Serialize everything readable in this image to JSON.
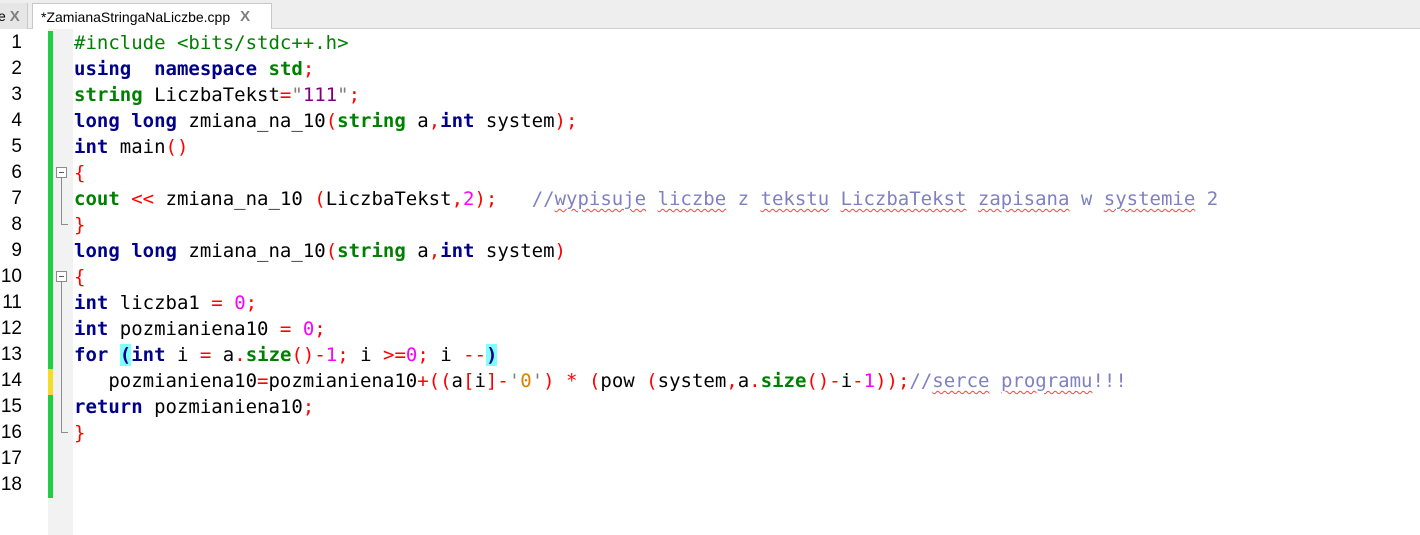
{
  "tabs": [
    {
      "label": "e",
      "close": "X"
    },
    {
      "label": "*ZamianaStringaNaLiczbe.cpp",
      "close": "X"
    }
  ],
  "lines": [
    {
      "n": "1",
      "tokens": [
        [
          "pre",
          "#include <bits/stdc++.h>"
        ]
      ]
    },
    {
      "n": "2",
      "tokens": [
        [
          "kw",
          "using"
        ],
        [
          "",
          "  "
        ],
        [
          "kw",
          "namespace"
        ],
        [
          "",
          " "
        ],
        [
          "ty",
          "std"
        ],
        [
          "op",
          ";"
        ]
      ]
    },
    {
      "n": "3",
      "tokens": [
        [
          "ty",
          "string"
        ],
        [
          "",
          " LiczbaTekst"
        ],
        [
          "op",
          "="
        ],
        [
          "strq",
          "\""
        ],
        [
          "strv",
          "111"
        ],
        [
          "strq",
          "\""
        ],
        [
          "op",
          ";"
        ]
      ]
    },
    {
      "n": "4",
      "tokens": [
        [
          "kw",
          "long"
        ],
        [
          "",
          " "
        ],
        [
          "kw",
          "long"
        ],
        [
          "",
          " zmiana_na_10"
        ],
        [
          "op",
          "("
        ],
        [
          "ty",
          "string"
        ],
        [
          "",
          " a"
        ],
        [
          "op",
          ","
        ],
        [
          "kw",
          "int"
        ],
        [
          "",
          " system"
        ],
        [
          "op",
          ");"
        ]
      ]
    },
    {
      "n": "5",
      "tokens": [
        [
          "kw",
          "int"
        ],
        [
          "",
          " main"
        ],
        [
          "op",
          "()"
        ]
      ]
    },
    {
      "n": "6",
      "tokens": [
        [
          "op",
          "{"
        ]
      ]
    },
    {
      "n": "7",
      "tokens": [
        [
          "ty",
          "cout"
        ],
        [
          "",
          " "
        ],
        [
          "op",
          "<<"
        ],
        [
          "",
          " zmiana_na_10 "
        ],
        [
          "op",
          "("
        ],
        [
          "",
          "LiczbaTekst"
        ],
        [
          "op",
          ","
        ],
        [
          "num",
          "2"
        ],
        [
          "op",
          ");"
        ],
        [
          "",
          "   "
        ],
        [
          "cm",
          "//"
        ],
        [
          "cm sq",
          "wypisuje"
        ],
        [
          "cm",
          " "
        ],
        [
          "cm sq",
          "liczbe"
        ],
        [
          "cm",
          " z "
        ],
        [
          "cm sq",
          "tekstu"
        ],
        [
          "cm",
          " "
        ],
        [
          "cm sq",
          "LiczbaTekst"
        ],
        [
          "cm",
          " "
        ],
        [
          "cm sq",
          "zapisana"
        ],
        [
          "cm",
          " w "
        ],
        [
          "cm sq",
          "systemie"
        ],
        [
          "cm",
          " 2"
        ]
      ]
    },
    {
      "n": "8",
      "tokens": [
        [
          "op",
          "}"
        ]
      ]
    },
    {
      "n": "9",
      "tokens": [
        [
          "kw",
          "long"
        ],
        [
          "",
          " "
        ],
        [
          "kw",
          "long"
        ],
        [
          "",
          " zmiana_na_10"
        ],
        [
          "op",
          "("
        ],
        [
          "ty",
          "string"
        ],
        [
          "",
          " a"
        ],
        [
          "op",
          ","
        ],
        [
          "kw",
          "int"
        ],
        [
          "",
          " system"
        ],
        [
          "op",
          ")"
        ]
      ]
    },
    {
      "n": "10",
      "tokens": [
        [
          "op",
          "{"
        ]
      ]
    },
    {
      "n": "11",
      "tokens": [
        [
          "kw",
          "int"
        ],
        [
          "",
          " liczba1 "
        ],
        [
          "op",
          "="
        ],
        [
          "",
          " "
        ],
        [
          "num",
          "0"
        ],
        [
          "op",
          ";"
        ]
      ]
    },
    {
      "n": "12",
      "tokens": [
        [
          "kw",
          "int"
        ],
        [
          "",
          " pozmianiena10 "
        ],
        [
          "op",
          "="
        ],
        [
          "",
          " "
        ],
        [
          "num",
          "0"
        ],
        [
          "op",
          ";"
        ]
      ]
    },
    {
      "n": "13",
      "tokens": [
        [
          "kw",
          "for"
        ],
        [
          "",
          " "
        ],
        [
          "kw br-hl",
          "("
        ],
        [
          "kw",
          "int"
        ],
        [
          "",
          " i "
        ],
        [
          "op",
          "="
        ],
        [
          "",
          " a"
        ],
        [
          "op",
          "."
        ],
        [
          "ty",
          "size"
        ],
        [
          "op",
          "()-"
        ],
        [
          "num",
          "1"
        ],
        [
          "op",
          ";"
        ],
        [
          "",
          " i "
        ],
        [
          "op",
          ">="
        ],
        [
          "num",
          "0"
        ],
        [
          "op",
          ";"
        ],
        [
          "",
          " i "
        ],
        [
          "op",
          "--"
        ],
        [
          "kw br-hl",
          ")"
        ]
      ]
    },
    {
      "n": "14",
      "tokens": [
        [
          "",
          "   pozmianiena10"
        ],
        [
          "op",
          "="
        ],
        [
          "",
          "pozmianiena10"
        ],
        [
          "op",
          "+(("
        ],
        [
          "",
          "a"
        ],
        [
          "op",
          "["
        ],
        [
          "",
          "i"
        ],
        [
          "op",
          "]-"
        ],
        [
          "chr",
          "'"
        ],
        [
          "chrv",
          "0"
        ],
        [
          "chr",
          "'"
        ],
        [
          "op",
          ")"
        ],
        [
          "",
          " "
        ],
        [
          "op",
          "*"
        ],
        [
          "",
          " "
        ],
        [
          "op",
          "("
        ],
        [
          "",
          "pow "
        ],
        [
          "op",
          "("
        ],
        [
          "",
          "system"
        ],
        [
          "op",
          ","
        ],
        [
          "",
          "a"
        ],
        [
          "op",
          "."
        ],
        [
          "ty",
          "size"
        ],
        [
          "op",
          "()-"
        ],
        [
          "",
          "i"
        ],
        [
          "op",
          "-"
        ],
        [
          "num",
          "1"
        ],
        [
          "op",
          "));"
        ],
        [
          "cm",
          "//"
        ],
        [
          "cm sq",
          "serce"
        ],
        [
          "cm",
          " "
        ],
        [
          "cm sq",
          "programu"
        ],
        [
          "cm",
          "!!!"
        ]
      ]
    },
    {
      "n": "15",
      "tokens": [
        [
          "kw",
          "return"
        ],
        [
          "",
          " pozmianiena10"
        ],
        [
          "op",
          ";"
        ]
      ]
    },
    {
      "n": "16",
      "tokens": [
        [
          "op",
          "}"
        ]
      ]
    },
    {
      "n": "17",
      "tokens": []
    },
    {
      "n": "18",
      "tokens": []
    }
  ],
  "colors": {
    "saved_change": "#22cc44",
    "unsaved_change": "#f5dc2a",
    "keyword": "#00008b",
    "type": "#008000",
    "operator": "#ff0000",
    "number": "#ff00ff",
    "comment": "#8080c0",
    "brace_match": "#80ffff"
  }
}
